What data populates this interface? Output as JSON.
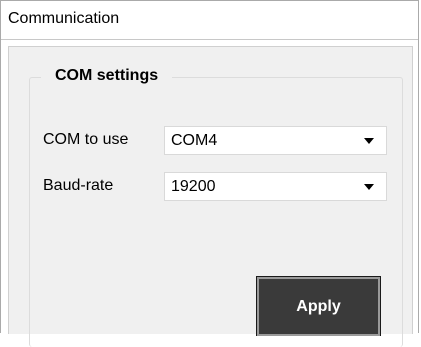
{
  "window": {
    "title": "Communication"
  },
  "group": {
    "legend": "COM settings"
  },
  "fields": {
    "com_port": {
      "label": "COM to use",
      "value": "COM4"
    },
    "baud_rate": {
      "label": "Baud-rate",
      "value": "19200"
    }
  },
  "actions": {
    "apply_label": "Apply"
  },
  "icons": {
    "dropdown": "chevron-down-icon"
  }
}
